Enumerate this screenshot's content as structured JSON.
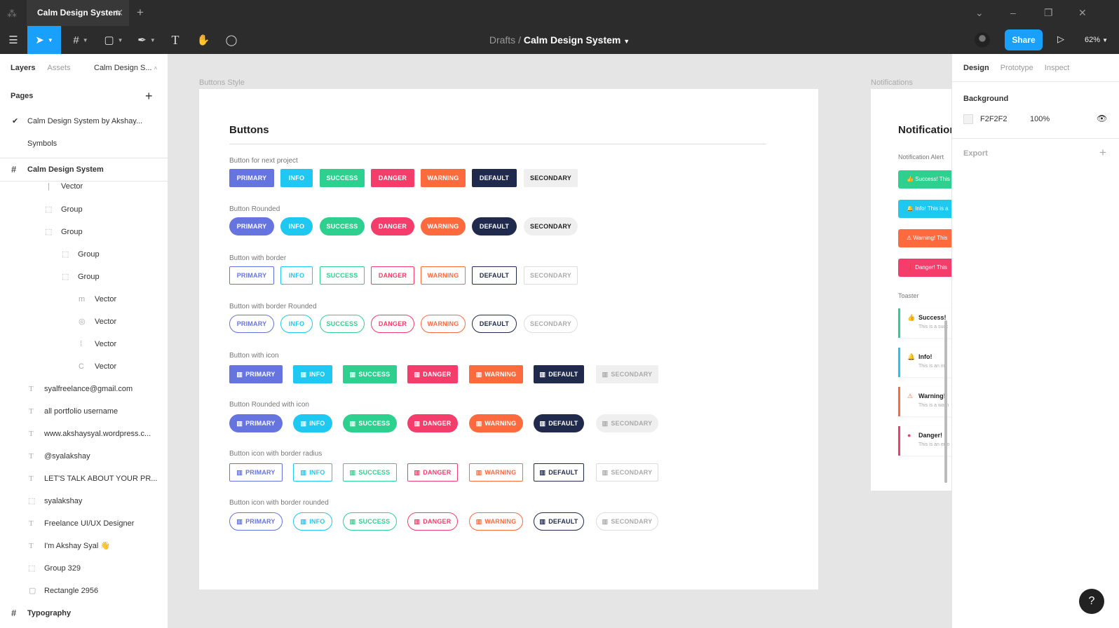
{
  "app": {
    "tab_title": "Calm Design System",
    "tab_close": "✕",
    "new_tab": "+"
  },
  "toolbar": {
    "breadcrumb_parent": "Drafts",
    "breadcrumb_sep": "/",
    "breadcrumb_current": "Calm Design System",
    "share_label": "Share",
    "zoom": "62%"
  },
  "left_panel": {
    "tabs": [
      "Layers",
      "Assets"
    ],
    "page_select": "Calm Design S...",
    "pages_header": "Pages",
    "pages": [
      "Calm Design System by Akshay...",
      "Symbols"
    ],
    "frame_name": "Calm Design System",
    "layers": [
      "Vector",
      "Group",
      "Group",
      "Group",
      "Group",
      "Vector",
      "Vector",
      "Vector",
      "Vector",
      "syalfreelance@gmail.com",
      "all portfolio username",
      "www.akshaysyal.wordpress.c...",
      "@syalakshay",
      "LET'S TALK ABOUT YOUR PR...",
      "syalakshay",
      "Freelance UI/UX Designer",
      "I'm Akshay Syal 👋",
      "Group 329",
      "Rectangle 2956"
    ],
    "next_frame": "Typography"
  },
  "canvas": {
    "buttons_frame_label": "Buttons Style",
    "notifications_frame_label": "Notifications",
    "buttons_title": "Buttons",
    "sections": [
      "Button for next project",
      "Button Rounded",
      "Button with border",
      "Button with border Rounded",
      "Button with icon",
      "Button Rounded with icon",
      "Button icon with border radius",
      "Button icon with border rounded"
    ],
    "button_labels": [
      "PRIMARY",
      "INFO",
      "SUCCESS",
      "DANGER",
      "WARNING",
      "DEFAULT",
      "SECONDARY"
    ],
    "colors": {
      "primary": "#6674e0",
      "info": "#1fc8f0",
      "success": "#2ed08f",
      "danger": "#f53d6b",
      "warning": "#fd6a3e",
      "default": "#1f2a4d",
      "secondary": "#efefef"
    },
    "notifications": {
      "title": "Notification",
      "alert_label": "Notification Alert",
      "alerts": [
        "Success! This",
        "Info! This is a",
        "Warning! This",
        "Danger! This"
      ],
      "toaster_label": "Toaster",
      "toasts": [
        {
          "title": "Success!",
          "desc": "This is a succ"
        },
        {
          "title": "Info!",
          "desc": "This is an inf"
        },
        {
          "title": "Warning!",
          "desc": "This is a warn"
        },
        {
          "title": "Danger!",
          "desc": "This is an erro"
        }
      ]
    }
  },
  "right_panel": {
    "tabs": [
      "Design",
      "Prototype",
      "Inspect"
    ],
    "background_label": "Background",
    "background_hex": "F2F2F2",
    "background_opacity": "100%",
    "export_label": "Export"
  },
  "help": "?"
}
